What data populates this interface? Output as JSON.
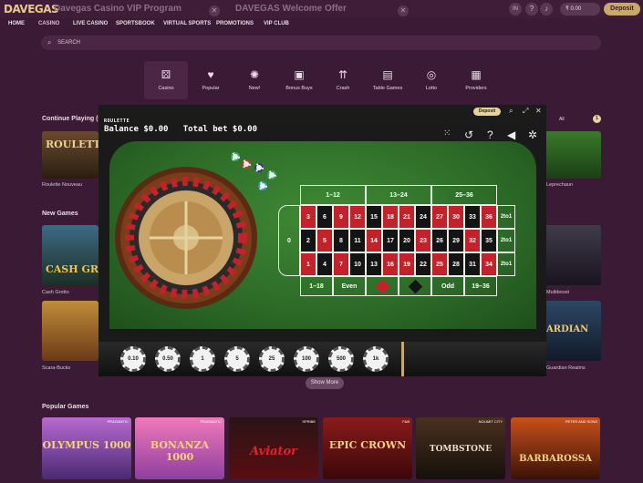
{
  "brand": {
    "logo": "DAVEGAS"
  },
  "promos": [
    "Davegas Casino VIP Program",
    "DAVEGAS Welcome Offer"
  ],
  "header": {
    "lang": "IN",
    "balance": "₹ 0.00",
    "deposit": "Deposit"
  },
  "nav": [
    "HOME",
    "CASINO",
    "LIVE CASINO",
    "SPORTSBOOK",
    "VIRTUAL SPORTS",
    "PROMOTIONS",
    "VIP CLUB"
  ],
  "search": {
    "placeholder": "SEARCH"
  },
  "categories": [
    "Casino",
    "Popular",
    "New!",
    "Bonus Buys",
    "Crash",
    "Table Games",
    "Lotto",
    "Providers"
  ],
  "sections": {
    "continue": "Continue Playing (6)",
    "new_games": "New Games",
    "popular": "Popular Games",
    "all_label": "All",
    "count": "1"
  },
  "tiles": {
    "roulette": "Roulette Nouveau",
    "cash": "Cash Grotto",
    "scara": "Scara-Bucks",
    "leprechaun": "Leprechaun",
    "multiboost": "Multiboost",
    "realms": "Guardian Realms"
  },
  "show_more": "Show More",
  "modal": {
    "deposit": "Deposit",
    "game_title": "ROULETTE",
    "balance_label": "Balance",
    "balance_value": "$0.00",
    "bet_label": "Total bet",
    "bet_value": "$0.00",
    "dozens": [
      "1–12",
      "13–24",
      "25–36"
    ],
    "zero": "0",
    "row1": [
      "3",
      "6",
      "9",
      "12",
      "15",
      "18",
      "21",
      "24",
      "27",
      "30",
      "33",
      "36"
    ],
    "row2": [
      "2",
      "5",
      "8",
      "11",
      "14",
      "17",
      "20",
      "23",
      "26",
      "29",
      "32",
      "35"
    ],
    "row3": [
      "1",
      "4",
      "7",
      "10",
      "13",
      "16",
      "19",
      "22",
      "25",
      "28",
      "31",
      "34"
    ],
    "columns": "2to1",
    "outside": [
      "1–18",
      "Even",
      "",
      "",
      "Odd",
      "19–36"
    ],
    "chips": [
      "0.10",
      "0.50",
      "1",
      "5",
      "25",
      "100",
      "500",
      "1k"
    ]
  },
  "popular_games": [
    {
      "title": "OLYMPUS 1000",
      "provider": "PRAGMATIC"
    },
    {
      "title": "BONANZA 1000",
      "provider": "PRAGMATIC"
    },
    {
      "title": "Aviator",
      "provider": "SPRIBE"
    },
    {
      "title": "EPIC CROWN",
      "provider": "F&B"
    },
    {
      "title": "TOMBSTONE",
      "provider": "NOLIMIT CITY"
    },
    {
      "title": "BARBAROSSA",
      "provider": "PETER AND SONS"
    }
  ],
  "colors": {
    "red": "#c4222b",
    "black": "#141414",
    "felt": "#2c6a27",
    "accent": "#c9a96a"
  }
}
